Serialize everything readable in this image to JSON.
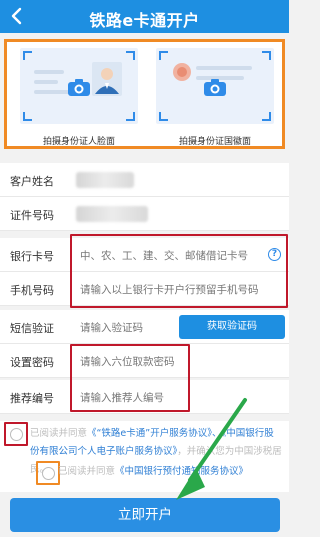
{
  "header": {
    "title": "铁路e卡通开户"
  },
  "id_capture": {
    "front_label": "拍摄身份证人脸面",
    "back_label": "拍摄身份证国徽面"
  },
  "form": {
    "name_label": "客户姓名",
    "id_label": "证件号码",
    "card_label": "银行卡号",
    "card_placeholder": "中、农、工、建、交、邮储借记卡号",
    "help_symbol": "?",
    "phone_label": "手机号码",
    "phone_placeholder": "请输入以上银行卡开户行预留手机号码",
    "sms_label": "短信验证",
    "sms_placeholder": "请输入验证码",
    "sms_button": "获取验证码",
    "password_label": "设置密码",
    "password_placeholder": "请输入六位取款密码",
    "referral_label": "推荐编号",
    "referral_placeholder": "请输入推荐人编号"
  },
  "agreement": {
    "text1_prefix": "已阅读并同意",
    "text1_link1": "《“铁路e卡通”开户服务协议》",
    "text1_comma": "、",
    "text1_link2": "《中国银行股份有限公司个人电子账户服务协议》",
    "text1_suffix": "，并确认您为中国涉税居民。",
    "text2_prefix": "已阅读并同意",
    "text2_link": "《中国银行预付通知服务协议》"
  },
  "submit": {
    "label": "立即开户"
  },
  "colors": {
    "primary": "#1e8fe1",
    "highlight_red": "#c0182b",
    "highlight_orange": "#f08a24",
    "arrow_green": "#2aa84a"
  },
  "icons": [
    "back-arrow-icon",
    "camera-icon",
    "help-icon",
    "green-arrow-icon"
  ]
}
